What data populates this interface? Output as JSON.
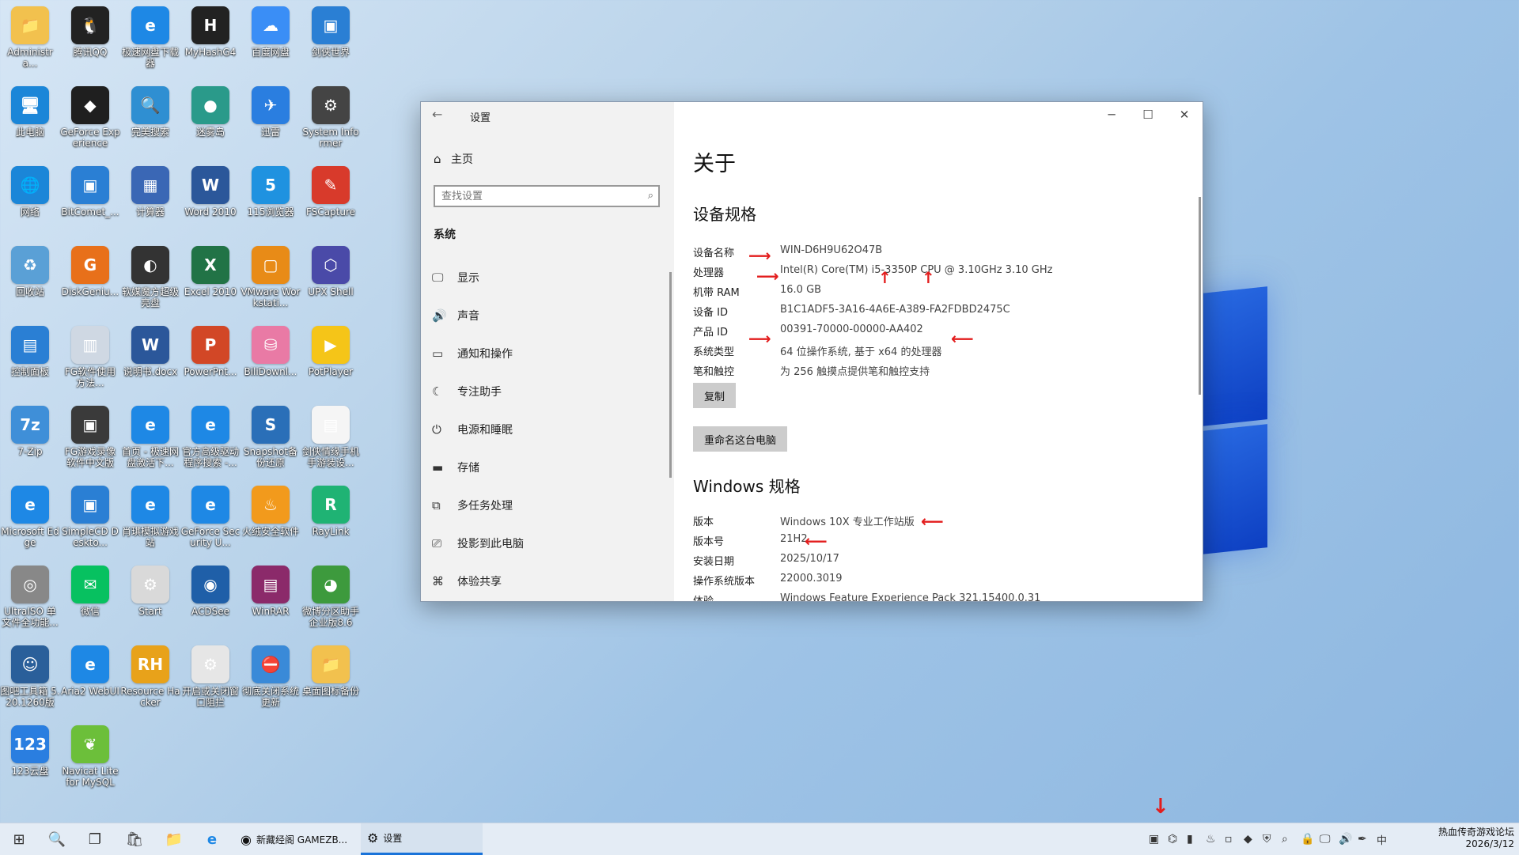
{
  "desktop_icons": [
    {
      "label": "Administra...",
      "color": "#f2c14e",
      "glyph": "📁"
    },
    {
      "label": "腾讯QQ",
      "color": "#222222",
      "glyph": "🐧"
    },
    {
      "label": "极速网盘下载器",
      "color": "#1e88e5",
      "glyph": "e"
    },
    {
      "label": "MyHashG4",
      "color": "#222222",
      "glyph": "H"
    },
    {
      "label": "百度网盘",
      "color": "#3a8ef6",
      "glyph": "☁"
    },
    {
      "label": "剑侠世界",
      "color": "#2a7fd4",
      "glyph": "▣"
    },
    {
      "label": "此电脑",
      "color": "#1b86d8",
      "glyph": "🖥"
    },
    {
      "label": "GeForce Experience",
      "color": "#1f1f1f",
      "glyph": "◆"
    },
    {
      "label": "完美搜索",
      "color": "#2f8fd2",
      "glyph": "🔍"
    },
    {
      "label": "迷雾岛",
      "color": "#2a9a8a",
      "glyph": "●"
    },
    {
      "label": "迅雷",
      "color": "#2a7ee0",
      "glyph": "✈"
    },
    {
      "label": "System Informer",
      "color": "#444444",
      "glyph": "⚙"
    },
    {
      "label": "网络",
      "color": "#1b86d8",
      "glyph": "🌐"
    },
    {
      "label": "BitComet_...",
      "color": "#2a7fd4",
      "glyph": "▣"
    },
    {
      "label": "计算器",
      "color": "#3a67b5",
      "glyph": "▦"
    },
    {
      "label": "Word 2010",
      "color": "#2b579a",
      "glyph": "W"
    },
    {
      "label": "115浏览器",
      "color": "#1f92e0",
      "glyph": "5"
    },
    {
      "label": "FSCapture",
      "color": "#d83a2b",
      "glyph": "✎"
    },
    {
      "label": "回收站",
      "color": "#5aa0d6",
      "glyph": "♻"
    },
    {
      "label": "DiskGeniu...",
      "color": "#e8701a",
      "glyph": "G"
    },
    {
      "label": "软媒魔方超级亮盘",
      "color": "#333333",
      "glyph": "◐"
    },
    {
      "label": "Excel 2010",
      "color": "#217346",
      "glyph": "X"
    },
    {
      "label": "VMware Workstati...",
      "color": "#e88b17",
      "glyph": "▢"
    },
    {
      "label": "UPX Shell",
      "color": "#4a4aa8",
      "glyph": "⬡"
    },
    {
      "label": "控制面板",
      "color": "#2a7fd4",
      "glyph": "▤"
    },
    {
      "label": "FG软件使用方法...",
      "color": "#cfd8e3",
      "glyph": "▥"
    },
    {
      "label": "说明书.docx",
      "color": "#2b579a",
      "glyph": "W"
    },
    {
      "label": "PowerPnt...",
      "color": "#d24726",
      "glyph": "P"
    },
    {
      "label": "BiliDownl...",
      "color": "#e97aa5",
      "glyph": "⛁"
    },
    {
      "label": "PotPlayer",
      "color": "#f5c518",
      "glyph": "▶"
    },
    {
      "label": "7-Zip",
      "color": "#3f8fd8",
      "glyph": "7z"
    },
    {
      "label": "FG游戏录像软件中文版",
      "color": "#3a3a3a",
      "glyph": "▣"
    },
    {
      "label": "首页 - 极速网盘激活下...",
      "color": "#1e88e5",
      "glyph": "e"
    },
    {
      "label": "官方高级驱动程序搜索 -...",
      "color": "#1e88e5",
      "glyph": "e"
    },
    {
      "label": "Snapshot备份还原",
      "color": "#2a6fb8",
      "glyph": "S"
    },
    {
      "label": "剑侠情缘手机手游装设...",
      "color": "#f5f5f5",
      "glyph": "▤"
    },
    {
      "label": "Microsoft Edge",
      "color": "#1e88e5",
      "glyph": "e"
    },
    {
      "label": "SimpleCD Deskto...",
      "color": "#2a7fd4",
      "glyph": "▣"
    },
    {
      "label": "肖琪模拟游戏站",
      "color": "#1e88e5",
      "glyph": "e"
    },
    {
      "label": "GeForce Security U...",
      "color": "#1e88e5",
      "glyph": "e"
    },
    {
      "label": "火绒安全软件",
      "color": "#f29a1c",
      "glyph": "♨"
    },
    {
      "label": "RayLink",
      "color": "#1fb374",
      "glyph": "R"
    },
    {
      "label": "UltraISO 单文件全功能...",
      "color": "#888888",
      "glyph": "◎"
    },
    {
      "label": "微信",
      "color": "#07c160",
      "glyph": "✉"
    },
    {
      "label": "Start",
      "color": "#d9d9d9",
      "glyph": "⚙"
    },
    {
      "label": "ACDSee",
      "color": "#1f5fa8",
      "glyph": "◉"
    },
    {
      "label": "WinRAR",
      "color": "#8b2a6a",
      "glyph": "▤"
    },
    {
      "label": "微博分区助手企业版8.6",
      "color": "#3d9a3d",
      "glyph": "◕"
    },
    {
      "label": "图吧工具箱 5.20.1260版",
      "color": "#2a5f9a",
      "glyph": "☺"
    },
    {
      "label": "Aria2 WebUI",
      "color": "#1e88e5",
      "glyph": "e"
    },
    {
      "label": "Resource Hacker",
      "color": "#e8a21a",
      "glyph": "RH"
    },
    {
      "label": "开启或关闭窗口阻拦",
      "color": "#e6e6e6",
      "glyph": "⚙"
    },
    {
      "label": "彻底关闭系统更新",
      "color": "#3a8ad8",
      "glyph": "⛔"
    },
    {
      "label": "桌面图标备份",
      "color": "#f2c14e",
      "glyph": "📁"
    },
    {
      "label": "123云盘",
      "color": "#2a7ee0",
      "glyph": "123"
    },
    {
      "label": "Navicat Lite for MySQL",
      "color": "#6cbf3a",
      "glyph": "❦"
    }
  ],
  "window": {
    "title": "设置",
    "back_icon": "←",
    "min": "─",
    "max": "☐",
    "close": "✕"
  },
  "sidebar": {
    "home_label": "主页",
    "search_placeholder": "查找设置",
    "section_label": "系统",
    "items": [
      {
        "label": "显示",
        "icon": "🖵"
      },
      {
        "label": "声音",
        "icon": "🔊"
      },
      {
        "label": "通知和操作",
        "icon": "▭"
      },
      {
        "label": "专注助手",
        "icon": "☾"
      },
      {
        "label": "电源和睡眠",
        "icon": "⏻"
      },
      {
        "label": "存储",
        "icon": "▬"
      },
      {
        "label": "多任务处理",
        "icon": "⧉"
      },
      {
        "label": "投影到此电脑",
        "icon": "⎚"
      },
      {
        "label": "体验共享",
        "icon": "⌘"
      }
    ]
  },
  "about": {
    "title": "关于",
    "device_spec_heading": "设备规格",
    "device_rows": [
      {
        "key": "设备名称",
        "value": "WIN-D6H9U62O47B"
      },
      {
        "key": "处理器",
        "value": "Intel(R) Core(TM) i5-3350P CPU @ 3.10GHz   3.10 GHz"
      },
      {
        "key": "机带 RAM",
        "value": "16.0 GB"
      },
      {
        "key": "设备 ID",
        "value": "B1C1ADF5-3A16-4A6E-A389-FA2FDBD2475C"
      },
      {
        "key": "产品 ID",
        "value": "00391-70000-00000-AA402"
      },
      {
        "key": "系统类型",
        "value": "64 位操作系统, 基于 x64 的处理器"
      },
      {
        "key": "笔和触控",
        "value": "为 256 触摸点提供笔和触控支持"
      }
    ],
    "copy_button": "复制",
    "rename_button": "重命名这台电脑",
    "windows_spec_heading": "Windows 规格",
    "windows_rows": [
      {
        "key": "版本",
        "value": "Windows 10X 专业工作站版"
      },
      {
        "key": "版本号",
        "value": "21H2"
      },
      {
        "key": "安装日期",
        "value": "2025/10/17"
      },
      {
        "key": "操作系统版本",
        "value": "22000.3019"
      },
      {
        "key": "体验",
        "value": "Windows Feature Experience Pack 321.15400.0.31"
      }
    ]
  },
  "taskbar": {
    "start_icon": "⊞",
    "search_icon": "🔍",
    "taskview_icon": "❐",
    "store_icon": "🛍",
    "explorer_icon": "📁",
    "edge_icon": "e",
    "app1_label": "新藏经阁 GAMEZB...",
    "app2_label": "设置",
    "ime": "中",
    "clock_line1": "热血传奇游戏论坛",
    "clock_line2": "2026/3/12"
  },
  "colors": {
    "accent": "#1a73d9",
    "annotation_red": "#e31d1d"
  }
}
